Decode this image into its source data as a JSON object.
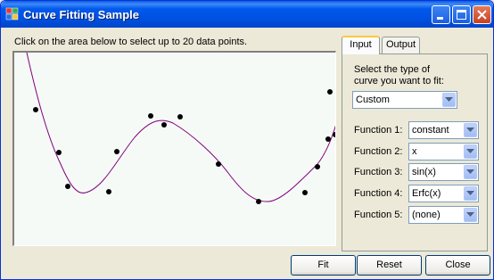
{
  "window": {
    "title": "Curve Fitting Sample"
  },
  "instruction": "Click on the area below to select up to 20 data points.",
  "tabs": [
    {
      "label": "Input",
      "active": true
    },
    {
      "label": "Output",
      "active": false
    }
  ],
  "input_panel": {
    "prompt_line1": "Select the type of",
    "prompt_line2": "curve you want to fit:",
    "curve_type": "Custom",
    "functions": [
      {
        "label": "Function 1:",
        "value": "constant"
      },
      {
        "label": "Function 2:",
        "value": "x"
      },
      {
        "label": "Function 3:",
        "value": "sin(x)"
      },
      {
        "label": "Function 4:",
        "value": "Erfc(x)"
      },
      {
        "label": "Function 5:",
        "value": "(none)"
      }
    ]
  },
  "buttons": {
    "fit": "Fit",
    "reset": "Reset",
    "close": "Close"
  },
  "colors": {
    "curve": "#800080",
    "points": "#000000",
    "plot_background": "#f6faf6",
    "title_bar": "#0055e5"
  }
}
